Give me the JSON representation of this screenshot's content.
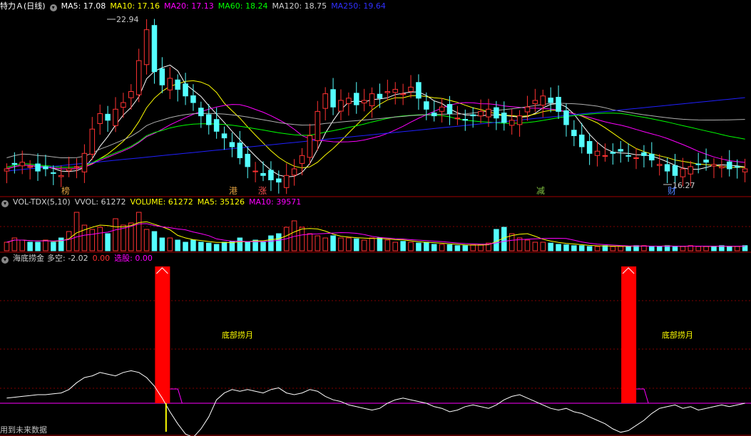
{
  "price_header": {
    "title": "特力Ａ(日线)",
    "ma5": "MA5: 17.08",
    "ma10": "MA10: 17.16",
    "ma20": "MA20: 17.13",
    "ma60": "MA60: 18.24",
    "ma120": "MA120: 18.75",
    "ma250": "MA250: 19.64"
  },
  "vol_header": {
    "title": "VOL-TDX(5,10)",
    "vvol": "VVOL: 61272",
    "volume": "VOLUME: 61272",
    "ma5": "MA5: 35126",
    "ma10": "MA10: 39571"
  },
  "ind_header": {
    "title": "海底捞金",
    "duokong": "多空: -2.02",
    "v1": "0.00",
    "xuangu": "选股: 0.00"
  },
  "price_annotations": {
    "high": "22.94",
    "low": "16.27"
  },
  "event_markers": [
    {
      "label": "榜",
      "color": "#e0a040"
    },
    {
      "label": "港",
      "color": "#e0a040"
    },
    {
      "label": "涨",
      "color": "#ff5050"
    },
    {
      "label": "减",
      "color": "#80c040"
    },
    {
      "label": "财",
      "color": "#5080ff"
    }
  ],
  "signal_label": "底部捞月",
  "footer_text": "用到未来数据",
  "colors": {
    "up": "#ff3232",
    "down": "#54ffff",
    "ma5": "#ffffff",
    "ma10": "#ffff00",
    "ma20": "#ff00ff",
    "ma60": "#00ff00",
    "ma120": "#b0b0b0",
    "ma250": "#2020ff",
    "signal": "#ff0000"
  },
  "chart_data": {
    "type": "candlestick",
    "series_close": [
      16.6,
      16.8,
      16.9,
      16.7,
      16.5,
      16.6,
      16.4,
      16.3,
      16.6,
      16.7,
      17.3,
      18.4,
      19.1,
      18.8,
      19.3,
      19.6,
      20.1,
      21.5,
      22.9,
      21.0,
      20.4,
      20.7,
      20.2,
      19.9,
      19.6,
      19.0,
      18.6,
      18.3,
      18.0,
      17.6,
      17.1,
      16.7,
      16.5,
      16.3,
      16.1,
      16.0,
      16.3,
      16.6,
      17.2,
      18.1,
      19.2,
      20.0,
      19.4,
      19.7,
      19.8,
      19.5,
      19.7,
      20.0,
      19.8,
      20.1,
      20.2,
      20.0,
      20.3,
      19.8,
      19.3,
      19.0,
      19.4,
      19.1,
      18.9,
      18.8,
      19.0,
      19.2,
      19.3,
      18.9,
      18.7,
      18.8,
      19.0,
      19.4,
      19.7,
      19.9,
      19.6,
      19.2,
      18.6,
      18.1,
      17.6,
      17.3,
      17.4,
      17.2,
      17.3,
      17.4,
      17.2,
      17.1,
      17.2,
      17.0,
      16.8,
      16.5,
      16.3,
      16.6,
      16.7,
      16.8,
      16.9,
      16.8,
      16.7,
      16.6,
      16.7,
      16.6
    ],
    "volume_levels": [
      0.2,
      0.3,
      0.25,
      0.2,
      0.2,
      0.25,
      0.2,
      0.3,
      0.45,
      0.9,
      0.6,
      0.5,
      0.55,
      0.4,
      0.75,
      0.6,
      0.65,
      0.9,
      0.5,
      0.45,
      0.3,
      0.3,
      0.25,
      0.2,
      0.25,
      0.2,
      0.18,
      0.15,
      0.2,
      0.22,
      0.3,
      0.2,
      0.25,
      0.2,
      0.35,
      0.4,
      0.55,
      0.7,
      0.55,
      0.4,
      0.35,
      0.3,
      0.35,
      0.3,
      0.3,
      0.28,
      0.25,
      0.3,
      0.3,
      0.25,
      0.2,
      0.22,
      0.2,
      0.18,
      0.2,
      0.15,
      0.15,
      0.14,
      0.12,
      0.12,
      0.14,
      0.15,
      0.18,
      0.5,
      0.55,
      0.4,
      0.3,
      0.25,
      0.2,
      0.2,
      0.18,
      0.15,
      0.14,
      0.12,
      0.12,
      0.1,
      0.1,
      0.12,
      0.1,
      0.1,
      0.1,
      0.12,
      0.12,
      0.1,
      0.1,
      0.12,
      0.1,
      0.1,
      0.12,
      0.1,
      0.1,
      0.1,
      0.12,
      0.1,
      0.1,
      0.12
    ],
    "duokong_line": [
      0.3,
      0.35,
      0.4,
      0.45,
      0.5,
      0.5,
      0.55,
      0.6,
      0.8,
      1.2,
      1.5,
      1.6,
      1.8,
      1.7,
      1.6,
      1.8,
      1.9,
      1.8,
      1.5,
      1.0,
      0.3,
      -0.5,
      -1.2,
      -1.8,
      -2.0,
      -1.5,
      -0.8,
      0.2,
      0.6,
      0.8,
      0.7,
      0.8,
      0.7,
      0.6,
      0.8,
      0.9,
      0.6,
      0.5,
      0.6,
      0.8,
      0.7,
      0.4,
      0.2,
      0.1,
      -0.1,
      -0.2,
      -0.3,
      -0.4,
      -0.3,
      0.0,
      0.2,
      0.3,
      0.2,
      0.1,
      0.0,
      -0.2,
      -0.3,
      -0.5,
      -0.4,
      -0.2,
      -0.1,
      -0.2,
      -0.3,
      -0.1,
      0.2,
      0.4,
      0.5,
      0.3,
      0.1,
      -0.1,
      -0.3,
      -0.4,
      -0.3,
      -0.5,
      -0.6,
      -0.8,
      -1.0,
      -1.2,
      -1.5,
      -1.7,
      -1.6,
      -1.3,
      -1.0,
      -0.6,
      -0.3,
      -0.2,
      -0.1,
      -0.3,
      -0.2,
      -0.4,
      -0.3,
      -0.2,
      -0.1,
      -0.2,
      -0.1,
      0.0
    ],
    "signal_bars": [
      {
        "index": 20
      },
      {
        "index": 80
      }
    ]
  }
}
